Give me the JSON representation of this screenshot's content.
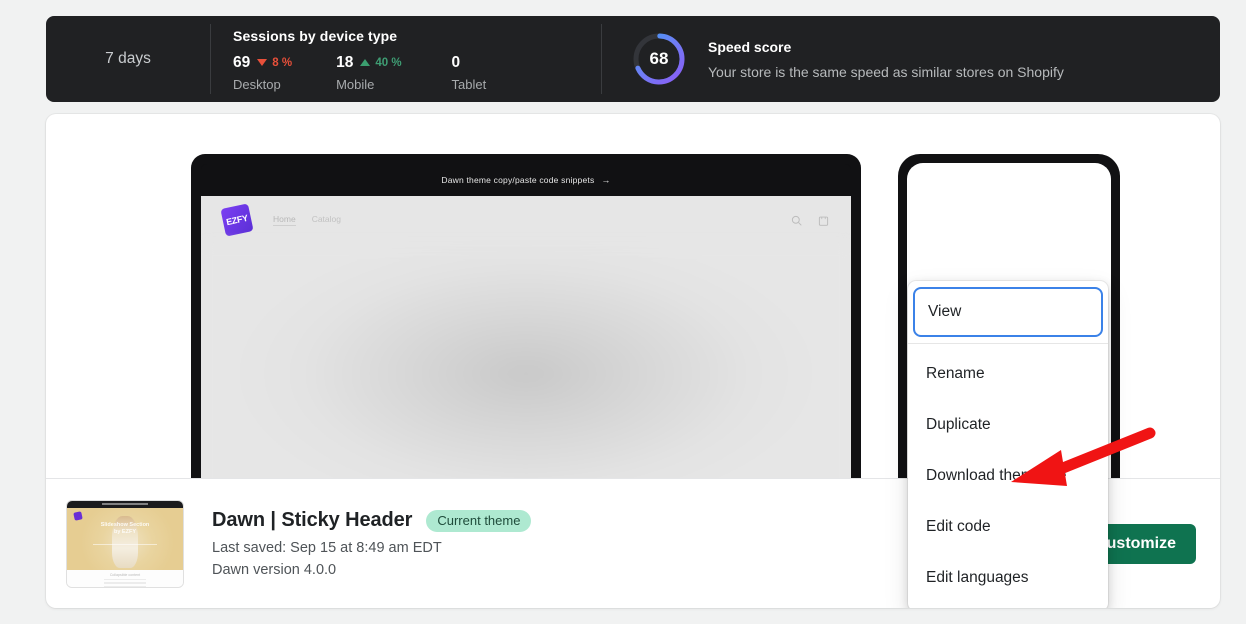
{
  "stats": {
    "range_label": "7 days",
    "sessions": {
      "title": "Sessions by device type",
      "devices": [
        {
          "value": "69",
          "delta": "8 %",
          "direction": "down",
          "label": "Desktop"
        },
        {
          "value": "18",
          "delta": "40 %",
          "direction": "up",
          "label": "Mobile"
        },
        {
          "value": "0",
          "delta": "",
          "direction": "none",
          "label": "Tablet"
        }
      ]
    },
    "speed": {
      "score": "68",
      "title": "Speed score",
      "subtitle": "Your store is the same speed as similar stores on Shopify",
      "ring_start_color": "#8b5cf6",
      "ring_end_color": "#3b9ef5",
      "ring_track_color": "#33353a"
    }
  },
  "preview": {
    "announcement": "Dawn theme copy/paste code snippets",
    "announcement_arrow": "→",
    "logo_text": "EZFY",
    "nav": [
      {
        "label": "Home",
        "active": true
      },
      {
        "label": "Catalog",
        "active": false
      }
    ],
    "icons": [
      {
        "name": "search-icon"
      },
      {
        "name": "cart-icon"
      }
    ]
  },
  "menu": {
    "focused_item": "View",
    "items": [
      "Rename",
      "Duplicate",
      "Download theme file",
      "Edit code",
      "Edit languages"
    ]
  },
  "theme": {
    "name": "Dawn | Sticky Header",
    "badge": "Current theme",
    "last_saved": "Last saved: Sep 15 at 8:49 am EDT",
    "version": "Dawn version 4.0.0",
    "thumbnail": {
      "hero_line1": "Slideshow Section",
      "hero_line2": "by EZFY",
      "footer_caption": "Collapsible content"
    }
  },
  "actions": {
    "more_label": "•••",
    "customize_label": "Customize",
    "customize_color": "#0f7350"
  },
  "annotation": {
    "arrow_color": "#f01414"
  }
}
